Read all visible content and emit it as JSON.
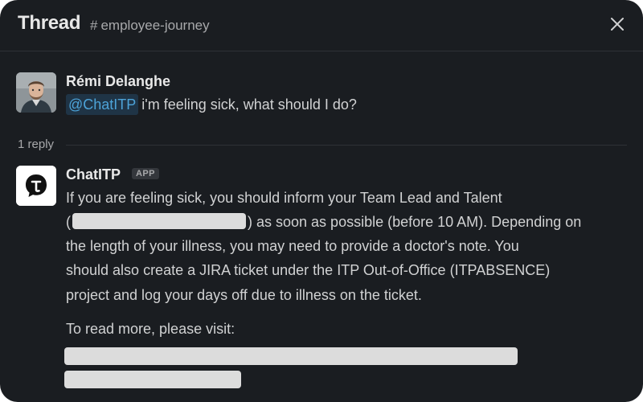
{
  "header": {
    "title": "Thread",
    "channel_hash": "#",
    "channel_name": "employee-journey"
  },
  "original_message": {
    "author": "Rémi Delanghe",
    "mention": "@ChatITP",
    "text": "i'm feeling sick, what should I do?"
  },
  "replies": {
    "count_label": "1 reply"
  },
  "reply_message": {
    "author": "ChatITP",
    "badge": "APP",
    "lines": [
      "If you are feeling sick, you should inform your Team Lead and Talent",
      "(",
      ") as soon as possible (before 10 AM). Depending on",
      "the length of your illness, you may need to provide a doctor's note. You",
      "should also create a JIRA ticket under the ITP Out-of-Office (ITPABSENCE)",
      "project and log your days off due to illness on the ticket."
    ],
    "read_more": "To read more, please visit:"
  },
  "icons": {
    "close": "close-icon",
    "chatitp_logo": "chatitp-logo-icon",
    "avatar": "user-avatar"
  },
  "colors": {
    "background": "#1a1d21",
    "mention": "#4da3d8",
    "redaction": "#dcdcdc"
  }
}
